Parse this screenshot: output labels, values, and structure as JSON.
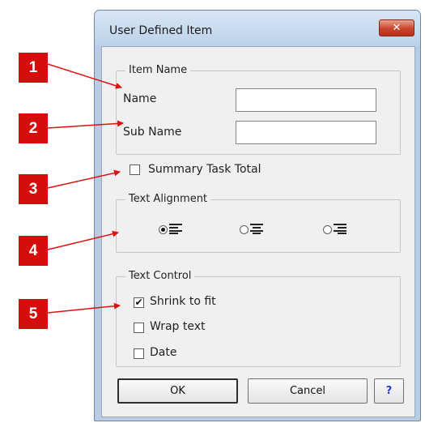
{
  "dialog": {
    "title": "User Defined Item",
    "close_label": "✕"
  },
  "item_name": {
    "legend": "Item Name",
    "name_label": "Name",
    "name_value": "",
    "sub_name_label": "Sub Name",
    "sub_name_value": ""
  },
  "summary_task_total": {
    "label": "Summary Task Total",
    "checked": false
  },
  "text_alignment": {
    "legend": "Text Alignment",
    "options": [
      {
        "icon": "align-left-icon",
        "checked": true
      },
      {
        "icon": "align-center-icon",
        "checked": false
      },
      {
        "icon": "align-right-icon",
        "checked": false
      }
    ]
  },
  "text_control": {
    "legend": "Text Control",
    "options": [
      {
        "label": "Shrink to fit",
        "checked": true
      },
      {
        "label": "Wrap text",
        "checked": false
      },
      {
        "label": "Date",
        "checked": false
      }
    ]
  },
  "buttons": {
    "ok": "OK",
    "cancel": "Cancel",
    "help": "?"
  },
  "callouts": [
    "1",
    "2",
    "3",
    "4",
    "5"
  ],
  "colors": {
    "callout": "#d50d0d",
    "arrow": "#e01010"
  }
}
